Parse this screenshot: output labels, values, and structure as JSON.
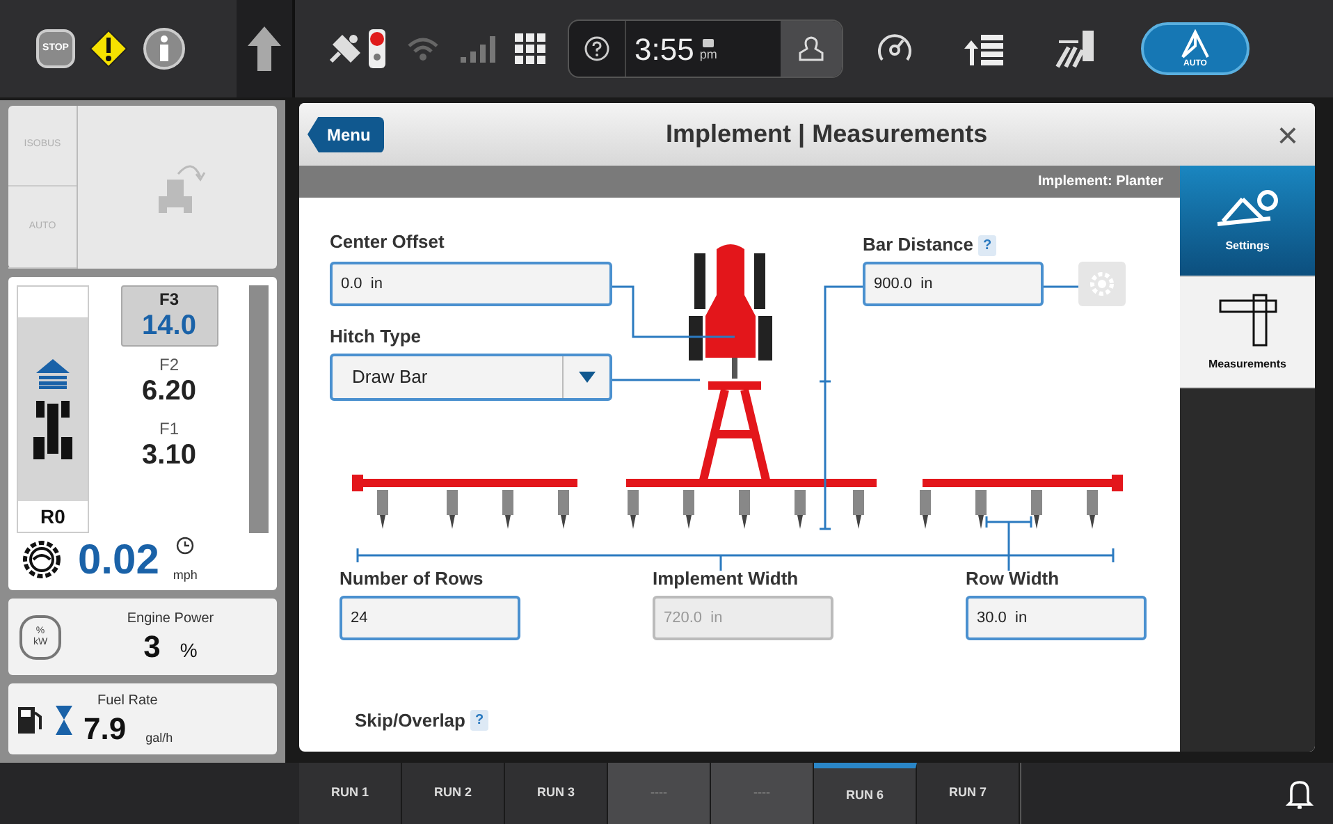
{
  "top_bar": {
    "stop_label": "STOP",
    "time": "3:55",
    "meridiem": "pm",
    "auto_label": "AUTO"
  },
  "left_panel": {
    "mode_buttons": [
      {
        "label": "ISOBUS",
        "disabled": true
      },
      {
        "label": "AUTO",
        "disabled": true
      }
    ],
    "gears": [
      {
        "name": "F3",
        "value": "14.0",
        "selected": true
      },
      {
        "name": "F2",
        "value": "6.20",
        "selected": false
      },
      {
        "name": "F1",
        "value": "3.10",
        "selected": false
      }
    ],
    "reverse_gear": "R0",
    "speed": "0.02",
    "speed_unit": "mph",
    "engine_power": {
      "label": "Engine Power",
      "value": "3",
      "unit": "%",
      "icon_top": "%",
      "icon_bottom": "kW"
    },
    "fuel_rate": {
      "label": "Fuel Rate",
      "value": "7.9",
      "unit": "gal/h"
    }
  },
  "window": {
    "menu_button": "Menu",
    "title": "Implement | Measurements",
    "close": "×",
    "subtitle": "Implement: Planter"
  },
  "form": {
    "center_offset": {
      "label": "Center Offset",
      "value": "0.0  in"
    },
    "hitch_type": {
      "label": "Hitch Type",
      "value": "Draw Bar"
    },
    "bar_distance": {
      "label": "Bar Distance",
      "help": "?",
      "value": "900.0  in"
    },
    "bottom_fields": [
      {
        "label": "Number of Rows",
        "value": "24",
        "disabled": false
      },
      {
        "label": "Implement Width",
        "value": "720.0  in",
        "disabled": true
      },
      {
        "label": "Row Width",
        "value": "30.0  in",
        "disabled": false
      }
    ],
    "skip_overlap": {
      "label": "Skip/Overlap",
      "help": "?"
    }
  },
  "side_nav": [
    {
      "label": "Settings",
      "selected": true
    },
    {
      "label": "Measurements",
      "selected": false
    }
  ],
  "run_tabs": [
    {
      "label": "RUN 1",
      "selected": false,
      "disabled": false
    },
    {
      "label": "RUN 2",
      "selected": false,
      "disabled": false
    },
    {
      "label": "RUN 3",
      "selected": false,
      "disabled": false
    },
    {
      "label": "----",
      "selected": false,
      "disabled": true
    },
    {
      "label": "----",
      "selected": false,
      "disabled": true
    },
    {
      "label": "RUN 6",
      "selected": true,
      "disabled": false
    },
    {
      "label": "RUN 7",
      "selected": false,
      "disabled": false
    }
  ]
}
